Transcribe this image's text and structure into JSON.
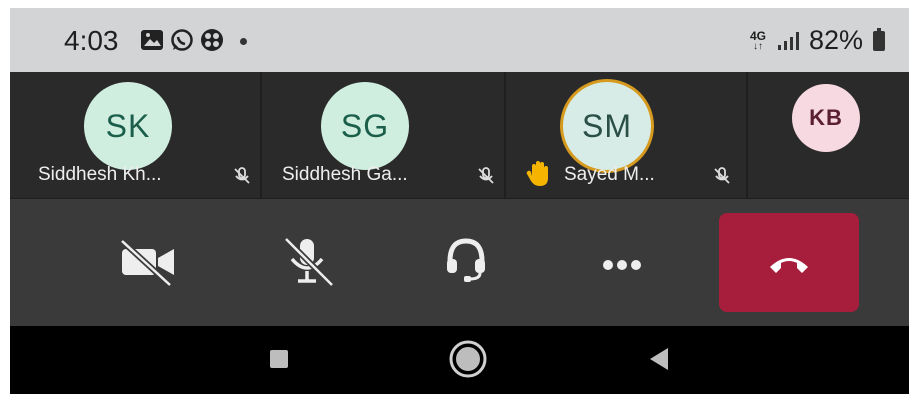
{
  "status_bar": {
    "time": "4:03",
    "network_type": "4G",
    "battery_percent": "82%"
  },
  "participants": [
    {
      "initials": "SK",
      "name": "Siddhesh Kh...",
      "muted": true,
      "speaking": false,
      "hand_raised": false
    },
    {
      "initials": "SG",
      "name": "Siddhesh Ga...",
      "muted": true,
      "speaking": false,
      "hand_raised": false
    },
    {
      "initials": "SM",
      "name": "Sayed M...",
      "muted": true,
      "speaking": true,
      "hand_raised": true
    },
    {
      "initials": "KB",
      "name": "",
      "muted": false,
      "speaking": false,
      "hand_raised": false
    }
  ],
  "controls": {
    "camera": "camera-off-icon",
    "mic": "mic-off-icon",
    "audio": "headset-icon",
    "more": "more-icon",
    "end_call": "end-call-icon"
  },
  "colors": {
    "end_call": "#a61e3c",
    "speaking_ring": "#d69a1f",
    "avatar_green": "#cfeee0",
    "avatar_pink": "#f6d9e1"
  }
}
